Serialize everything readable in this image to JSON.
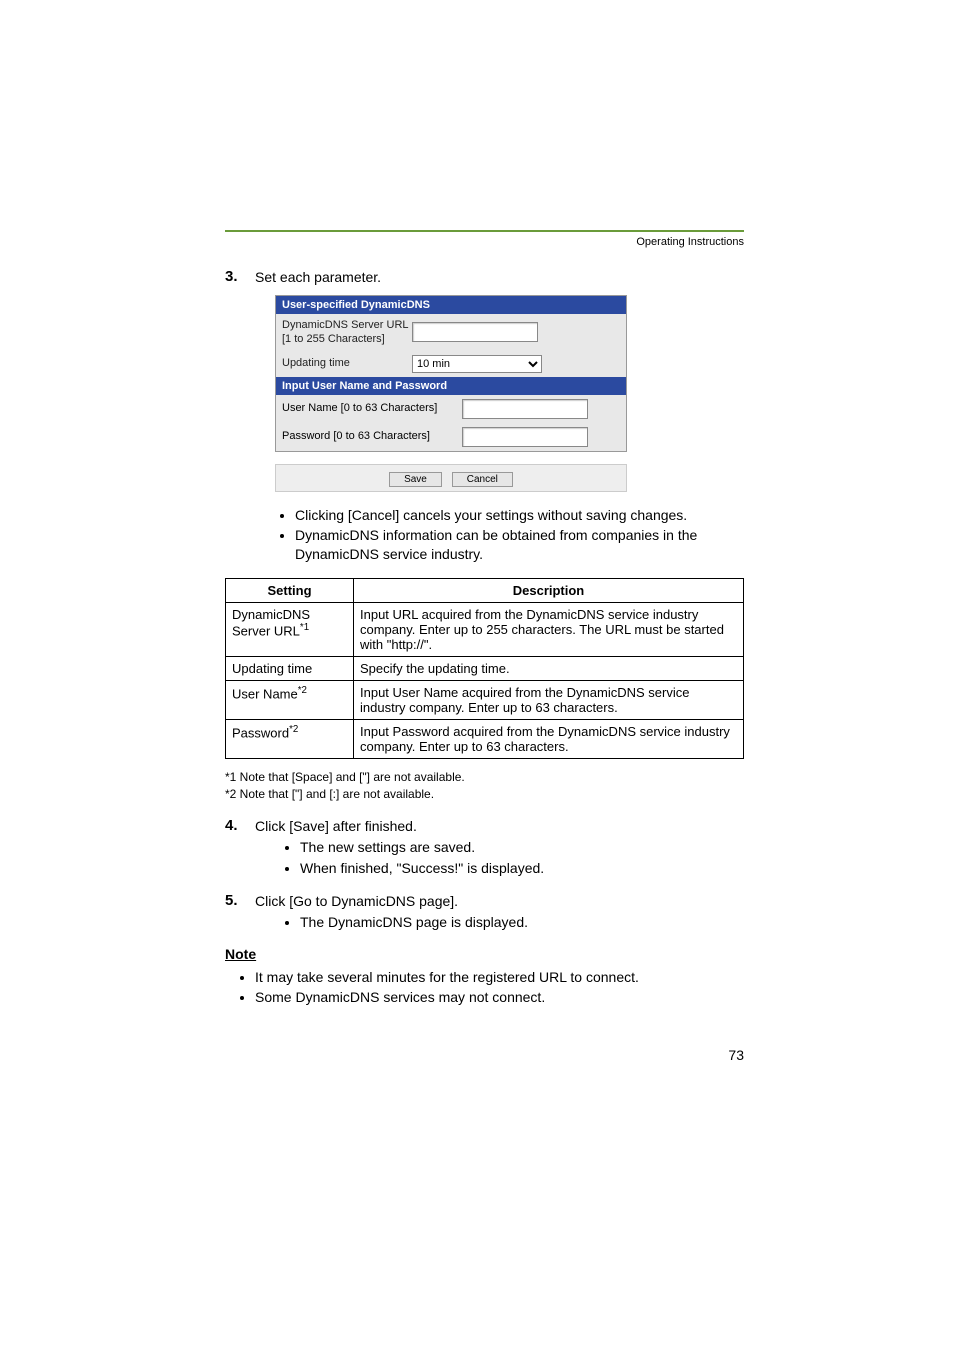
{
  "header": {
    "operating_instructions": "Operating Instructions"
  },
  "steps": {
    "s3": {
      "num": "3.",
      "text": "Set each parameter."
    },
    "s4": {
      "num": "4.",
      "text": "Click [Save] after finished."
    },
    "s5": {
      "num": "5.",
      "text": "Click [Go to DynamicDNS page]."
    }
  },
  "panel": {
    "header1": "User-specified DynamicDNS",
    "server_url_label": "DynamicDNS Server URL [1 to 255 Characters]",
    "updating_time_label": "Updating time",
    "updating_time_value": "10 min",
    "header2": "Input User Name and Password",
    "user_label": "User Name [0 to 63 Characters]",
    "pass_label": "Password [0 to 63 Characters]",
    "save_btn": "Save",
    "cancel_btn": "Cancel"
  },
  "info": {
    "b1": "Clicking [Cancel] cancels your settings without saving changes.",
    "b2": "DynamicDNS information can be obtained from companies in the DynamicDNS service industry."
  },
  "table": {
    "h1": "Setting",
    "h2": "Description",
    "r1s": "DynamicDNS Server URL",
    "r1s_sup": "*1",
    "r1d": "Input URL acquired from the DynamicDNS service industry company. Enter up to 255 characters. The URL must be started with \"http://\".",
    "r2s": "Updating time",
    "r2d": "Specify the updating time.",
    "r3s": "User Name",
    "r3s_sup": "*2",
    "r3d": "Input User Name acquired from the DynamicDNS service industry company. Enter up to 63 characters.",
    "r4s": "Password",
    "r4s_sup": "*2",
    "r4d": "Input Password acquired from the DynamicDNS service industry company. Enter up to 63 characters."
  },
  "footnotes": {
    "f1": "*1 Note that [Space] and [\"] are not available.",
    "f2": "*2 Note that [\"] and [:] are not available."
  },
  "step4": {
    "b1": "The new settings are saved.",
    "b2": "When finished, \"Success!\" is displayed."
  },
  "step5": {
    "b1": "The DynamicDNS page is displayed."
  },
  "note": {
    "heading": "Note",
    "b1": "It may take several minutes for the registered URL to connect.",
    "b2": "Some DynamicDNS services may not connect."
  },
  "page_number": "73"
}
